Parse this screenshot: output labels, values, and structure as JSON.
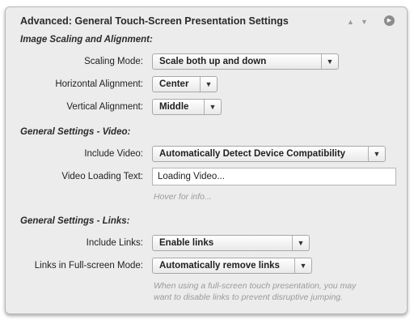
{
  "header": {
    "title": "Advanced: General Touch-Screen Presentation Settings",
    "up_glyph": "▲",
    "down_glyph": "▼",
    "play_glyph": "▶"
  },
  "image_scaling": {
    "section_title": "Image Scaling and Alignment:",
    "scaling_mode": {
      "label": "Scaling Mode:",
      "value": "Scale both up and down"
    },
    "horizontal_alignment": {
      "label": "Horizontal Alignment:",
      "value": "Center"
    },
    "vertical_alignment": {
      "label": "Vertical Alignment:",
      "value": "Middle"
    }
  },
  "video": {
    "section_title": "General Settings - Video:",
    "include_video": {
      "label": "Include Video:",
      "value": "Automatically Detect Device Compatibility"
    },
    "loading_text": {
      "label": "Video Loading Text:",
      "value": "Loading Video..."
    },
    "hint": "Hover for info..."
  },
  "links": {
    "section_title": "General Settings - Links:",
    "include_links": {
      "label": "Include Links:",
      "value": "Enable links"
    },
    "fullscreen_mode": {
      "label": "Links in Full-screen Mode:",
      "value": "Automatically remove links"
    },
    "hint_line1": "When using a full-screen touch presentation, you may",
    "hint_line2": "want to disable links to prevent disruptive jumping."
  },
  "icons": {
    "dropdown_arrow": "▼"
  },
  "colors": {
    "panel_bg": "#ececec",
    "hint_text": "#9a9a9a",
    "border": "#b9b9b9"
  }
}
